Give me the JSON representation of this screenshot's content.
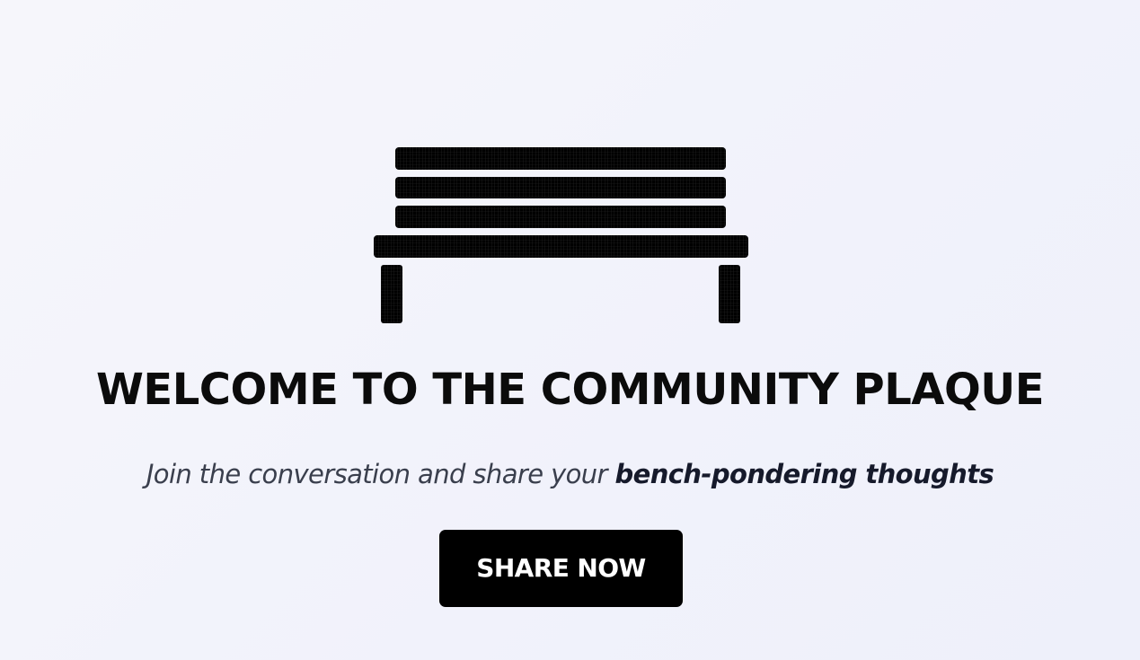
{
  "hero": {
    "icon": "bench-icon",
    "title": "WELCOME TO THE COMMUNITY PLAQUE",
    "subtitle_lead": "Join the conversation and share your ",
    "subtitle_emphasis": "bench-pondering thoughts",
    "cta_label": "SHARE NOW"
  },
  "colors": {
    "background": "#f3f3fb",
    "bench": "#000000",
    "title": "#0b0b0b",
    "subtitle": "#3a3f4d",
    "button_bg": "#000000",
    "button_text": "#ffffff"
  }
}
